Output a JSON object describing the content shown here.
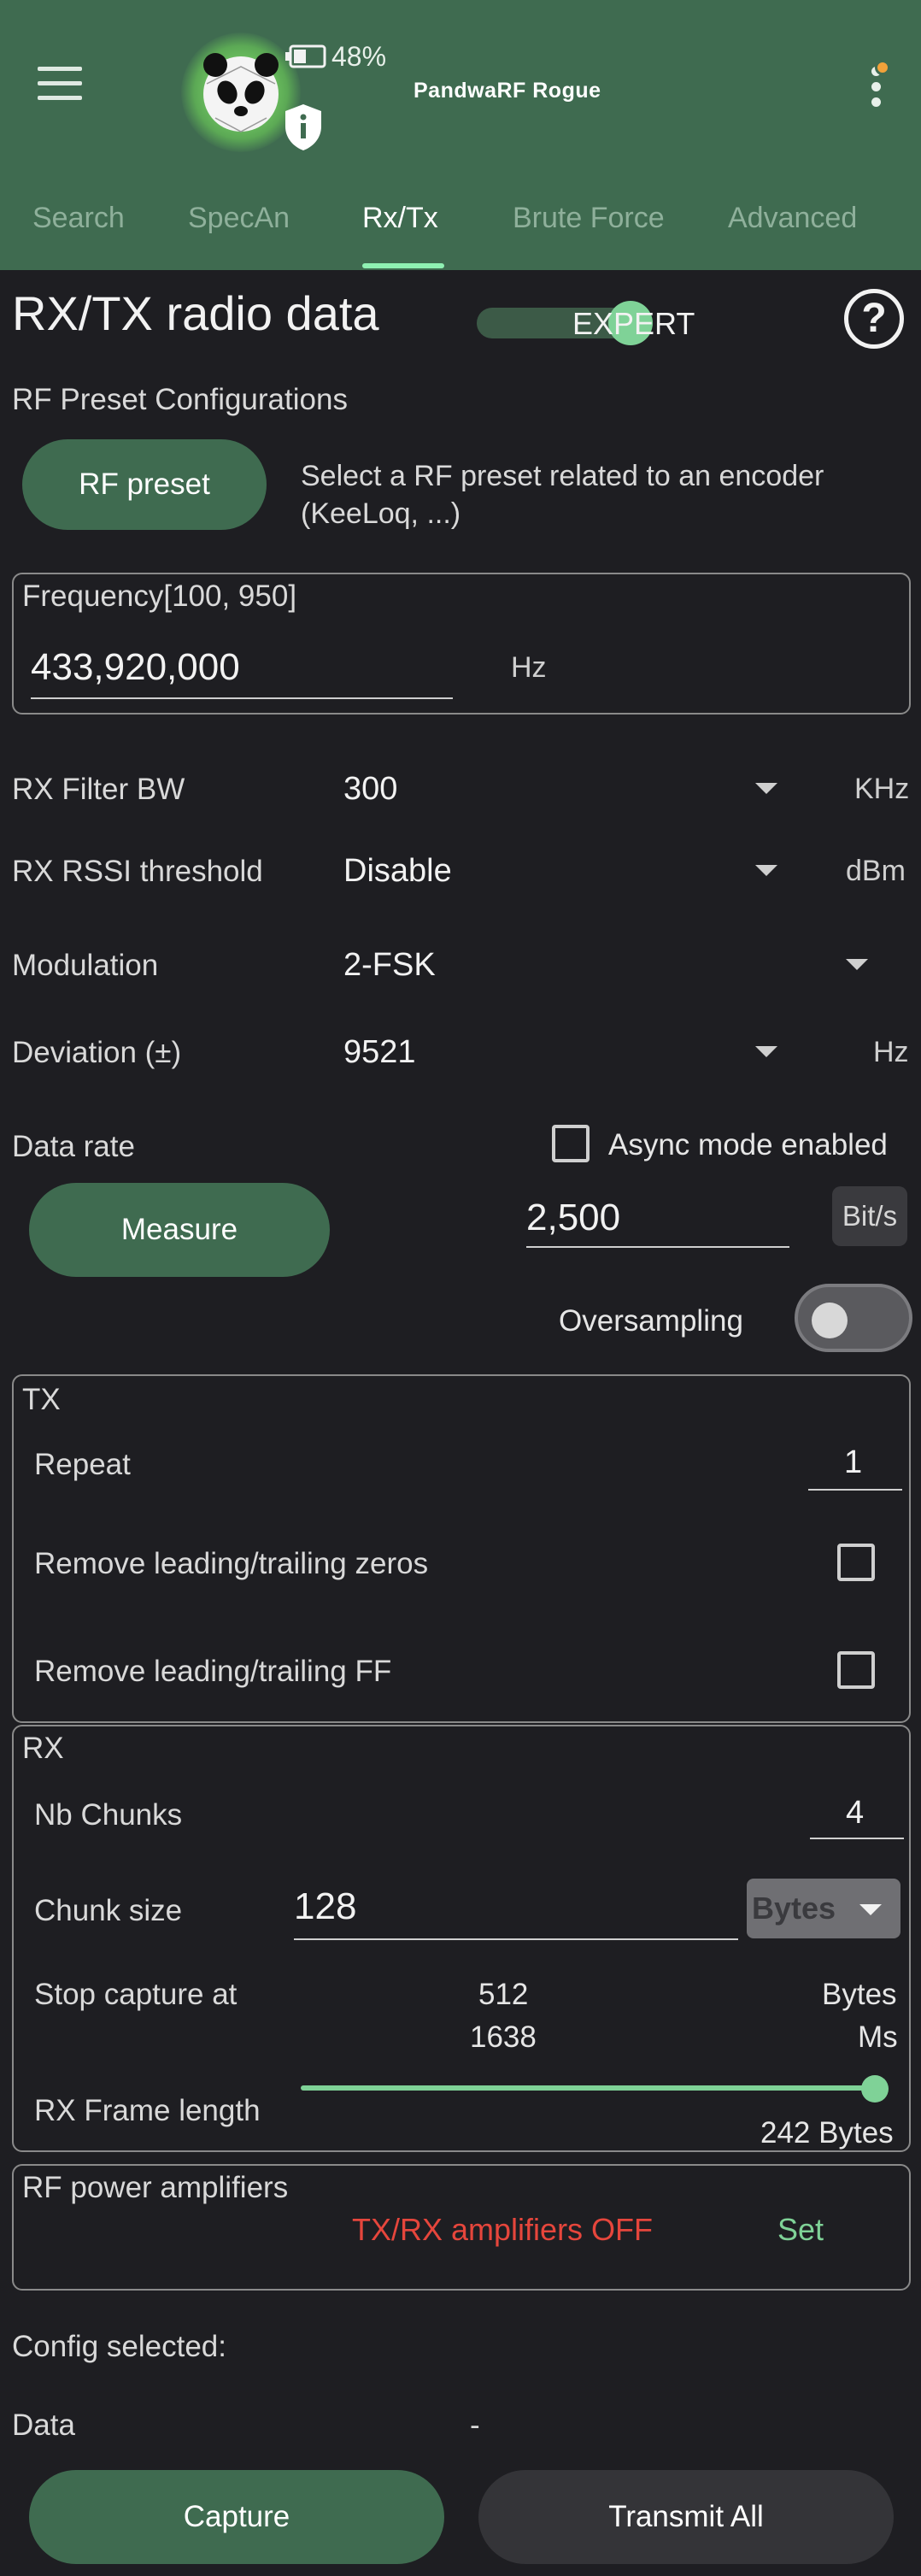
{
  "header": {
    "battery_pct": "48%",
    "device_name": "PandwaRF Rogue",
    "tabs": [
      {
        "label": "Search"
      },
      {
        "label": "SpecAn"
      },
      {
        "label": "Rx/Tx"
      },
      {
        "label": "Brute Force"
      },
      {
        "label": "Advanced"
      }
    ],
    "active_tab": "Rx/Tx"
  },
  "page": {
    "title": "RX/TX radio data",
    "expert_label": "EXPERT",
    "expert_enabled": true,
    "help_glyph": "?"
  },
  "preset": {
    "section_label": "RF Preset Configurations",
    "button_label": "RF preset",
    "description_line1": "Select a RF preset related to an encoder",
    "description_line2": "(KeeLoq, ...)"
  },
  "frequency": {
    "legend": "Frequency[100, 950]",
    "value": "433,920,000",
    "unit": "Hz"
  },
  "settings": {
    "rx_filter_bw": {
      "label": "RX Filter BW",
      "value": "300",
      "unit": "KHz"
    },
    "rx_rssi": {
      "label": "RX RSSI threshold",
      "value": "Disable",
      "unit": "dBm"
    },
    "modulation": {
      "label": "Modulation",
      "value": "2-FSK"
    },
    "deviation": {
      "label": "Deviation (±)",
      "value": "9521",
      "unit": "Hz"
    }
  },
  "datarate": {
    "label": "Data rate",
    "async_label": "Async mode enabled",
    "async_checked": false,
    "measure_label": "Measure",
    "value": "2,500",
    "unit": "Bit/s",
    "oversampling_label": "Oversampling",
    "oversampling_on": false
  },
  "tx": {
    "title": "TX",
    "repeat_label": "Repeat",
    "repeat_value": "1",
    "remove_zeros_label": "Remove leading/trailing zeros",
    "remove_ff_label": "Remove leading/trailing FF"
  },
  "rx": {
    "title": "RX",
    "nb_chunks_label": "Nb Chunks",
    "nb_chunks_value": "4",
    "chunk_size_label": "Chunk size",
    "chunk_size_value": "128",
    "chunk_unit": "Bytes",
    "stop_capture_label": "Stop capture at",
    "stop_bytes": "512",
    "stop_bytes_unit": "Bytes",
    "stop_ms": "1638",
    "stop_ms_unit": "Ms",
    "frame_length_label": "RX Frame length",
    "frame_length_value": "242 Bytes",
    "frame_length_fraction": 1.0
  },
  "amplifiers": {
    "title": "RF power amplifiers",
    "status": "TX/RX amplifiers OFF",
    "set_label": "Set"
  },
  "footer": {
    "config_label": "Config selected:",
    "data_label": "Data",
    "data_value": "-",
    "capture_label": "Capture",
    "transmit_label": "Transmit All"
  },
  "colors": {
    "accent": "#3f6b50",
    "accent_light": "#7fd297",
    "warning": "#e6463c",
    "background": "#1e1e22"
  },
  "icons": [
    "hamburger-menu-icon",
    "panda-logo-icon",
    "battery-icon",
    "shield-info-icon",
    "overflow-menu-icon",
    "help-icon",
    "dropdown-arrow-icon"
  ]
}
